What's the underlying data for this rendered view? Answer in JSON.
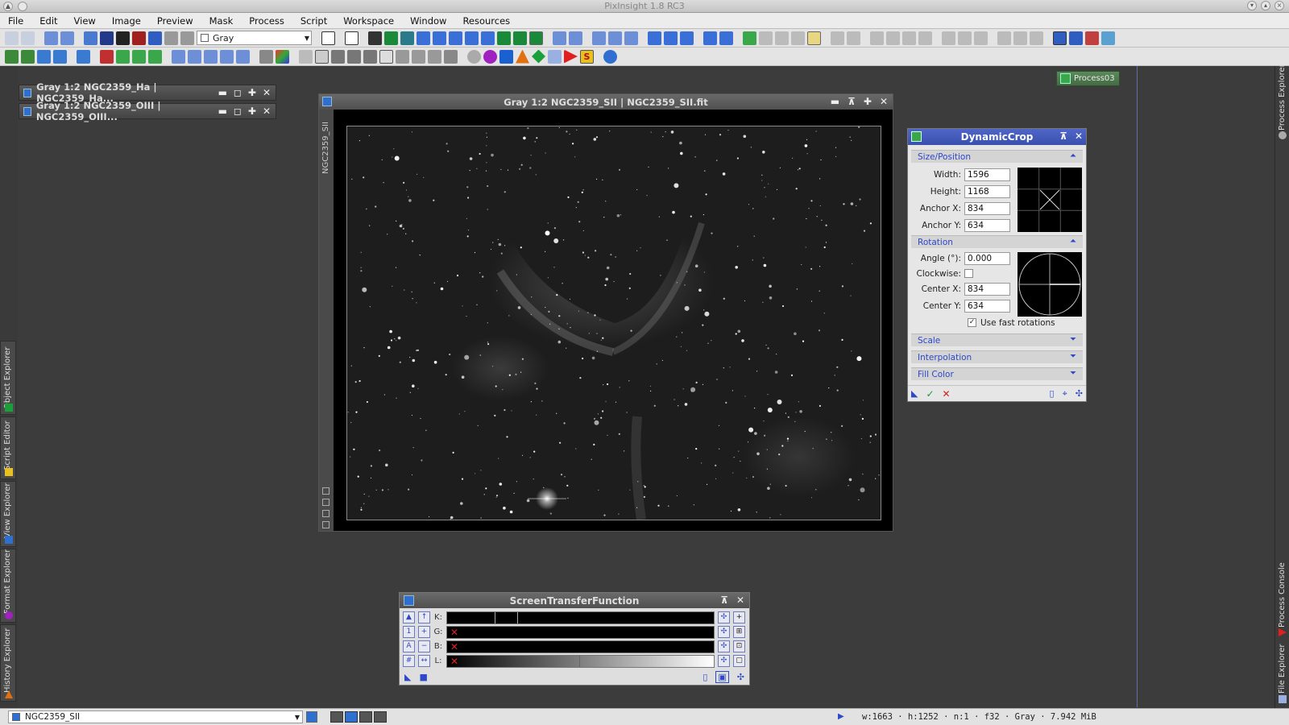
{
  "app_title": "PixInsight 1.8 RC3",
  "menu": [
    "File",
    "Edit",
    "View",
    "Image",
    "Preview",
    "Mask",
    "Process",
    "Script",
    "Workspace",
    "Window",
    "Resources"
  ],
  "toolbar": {
    "colorspace_combo": "Gray"
  },
  "left_tabs": [
    "Object Explorer",
    "Script Editor",
    "View Explorer",
    "Format Explorer",
    "History Explorer"
  ],
  "right_tabs": [
    "Process Explorer",
    "Process Console",
    "File Explorer"
  ],
  "icon_windows": [
    {
      "title": "Gray 1:2 NGC2359_Ha | NGC2359_Ha..."
    },
    {
      "title": "Gray 1:2 NGC2359_OIII | NGC2359_OIII..."
    }
  ],
  "image_window": {
    "title": "Gray 1:2 NGC2359_SII | NGC2359_SII.fit",
    "side_label": "NGC2359_SII"
  },
  "process_icon": {
    "label": "Process03"
  },
  "dynamic_crop": {
    "title": "DynamicCrop",
    "size_position": {
      "label": "Size/Position",
      "width_label": "Width:",
      "width": "1596",
      "height_label": "Height:",
      "height": "1168",
      "anchor_x_label": "Anchor X:",
      "anchor_x": "834",
      "anchor_y_label": "Anchor Y:",
      "anchor_y": "634"
    },
    "rotation": {
      "label": "Rotation",
      "angle_label": "Angle (°):",
      "angle": "0.000",
      "clockwise_label": "Clockwise:",
      "center_x_label": "Center X:",
      "center_x": "834",
      "center_y_label": "Center Y:",
      "center_y": "634",
      "fast_rotations_label": "Use fast rotations",
      "fast_rotations": true
    },
    "collapsed_sections": [
      "Scale",
      "Interpolation",
      "Fill Color"
    ]
  },
  "stf": {
    "title": "ScreenTransferFunction",
    "channels": [
      "K:",
      "G:",
      "B:",
      "L:"
    ]
  },
  "statusbar": {
    "view_combo": "NGC2359_SII",
    "info": "w:1663 · h:1252 · n:1 · f32 · Gray · 7.942 MiB"
  },
  "colors": {
    "accent_blue": "#3a50ae",
    "section_text": "#2d48c8",
    "background": "#3c3c3c"
  }
}
